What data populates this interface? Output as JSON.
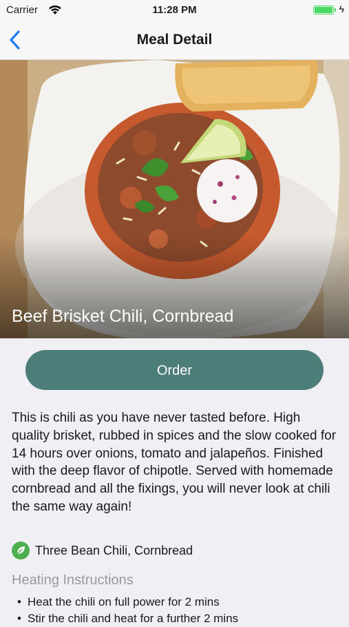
{
  "status_bar": {
    "carrier": "Carrier",
    "time": "11:28 PM"
  },
  "nav": {
    "title": "Meal Detail"
  },
  "meal": {
    "name": "Beef Brisket Chili, Cornbread",
    "description": "This is chili as you have never tasted before. High quality brisket, rubbed in spices and the slow cooked for 14 hours over onions, tomato and jalapeños. Finished with the deep flavor of chipotle. Served with homemade cornbread and all the fixings, you will never look at chili the same way again!",
    "tag": "Three Bean Chili, Cornbread"
  },
  "order": {
    "label": "Order"
  },
  "heating": {
    "title": "Heating Instructions",
    "steps": [
      "Heat the chili on full power for 2 mins",
      "Stir the chili and heat for a further 2 mins"
    ]
  },
  "colors": {
    "accent": "#4d7d78",
    "tag_icon": "#4caf50",
    "nav_tint": "#1c7cf4"
  },
  "icons": {
    "back": "chevron-left-icon",
    "tag": "leaf-icon"
  }
}
